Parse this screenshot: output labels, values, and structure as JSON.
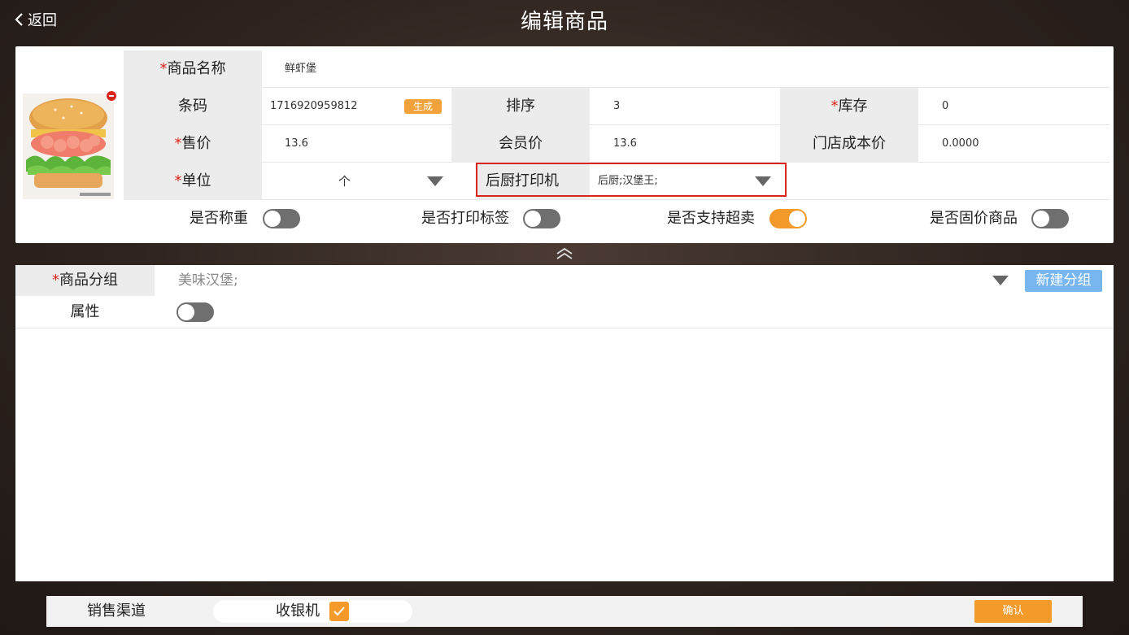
{
  "header": {
    "back_label": "返回",
    "title": "编辑商品"
  },
  "product": {
    "name_label": "商品名称",
    "name_value": "鲜虾堡",
    "barcode_label": "条码",
    "barcode_value": "1716920959812",
    "generate_label": "生成",
    "sort_label": "排序",
    "sort_value": "3",
    "stock_label": "库存",
    "stock_value": "0",
    "price_label": "售价",
    "price_value": "13.6",
    "member_price_label": "会员价",
    "member_price_value": "13.6",
    "store_cost_label": "门店成本价",
    "store_cost_value": "0.0000",
    "unit_label": "单位",
    "unit_value": "个",
    "kitchen_printer_label": "后厨打印机",
    "kitchen_printer_value": "后厨;汉堡王;",
    "required_mark": "*"
  },
  "toggles": [
    {
      "label": "是否称重",
      "on": false
    },
    {
      "label": "是否打印标签",
      "on": false
    },
    {
      "label": "是否支持超卖",
      "on": true
    },
    {
      "label": "是否固价商品",
      "on": false
    }
  ],
  "group": {
    "label": "商品分组",
    "value": "美味汉堡;",
    "new_group_label": "新建分组",
    "attribute_label": "属性",
    "attribute_on": false
  },
  "footer": {
    "channel_label": "销售渠道",
    "cashier_label": "收银机",
    "cashier_checked": true,
    "confirm_label": "确认"
  },
  "colors": {
    "accent": "#f39a2b",
    "required": "#d9261c",
    "blue_button": "#78b6f0"
  }
}
